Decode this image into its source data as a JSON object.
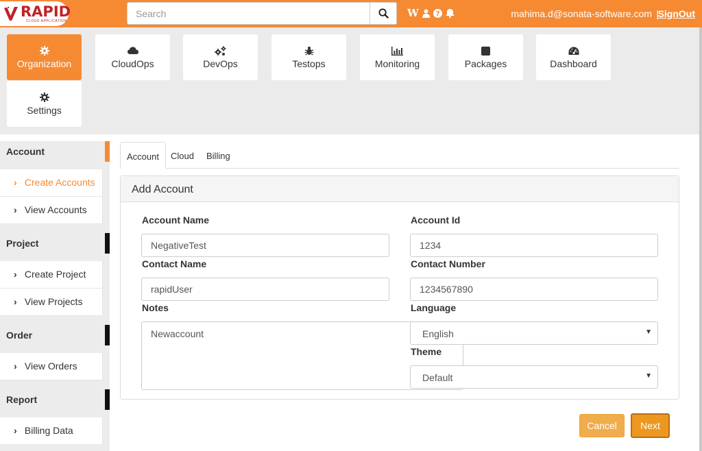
{
  "header": {
    "logo_text": "RAPID",
    "logo_subtext": "CLOUD APPLICATION",
    "search_placeholder": "Search",
    "user_email": "mahima.d@sonata-software.com",
    "separator": "|",
    "signout_label": "SignOut",
    "icons": [
      "wikipedia-icon",
      "user-icon",
      "help-icon",
      "bell-icon"
    ],
    "wiki_glyph": "W"
  },
  "modules": [
    {
      "label": "Organization",
      "icon": "gear-icon",
      "active": true
    },
    {
      "label": "CloudOps",
      "icon": "cloud-icon"
    },
    {
      "label": "DevOps",
      "icon": "gears-icon"
    },
    {
      "label": "Testops",
      "icon": "bug-icon"
    },
    {
      "label": "Monitoring",
      "icon": "bar-chart-icon"
    },
    {
      "label": "Packages",
      "icon": "package-icon"
    },
    {
      "label": "Dashboard",
      "icon": "dashboard-icon"
    },
    {
      "label": "Settings",
      "icon": "gear-icon"
    }
  ],
  "sidebar": {
    "sections": [
      {
        "title": "Account",
        "items": [
          "Create Accounts",
          "View Accounts"
        ]
      },
      {
        "title": "Project",
        "items": [
          "Create Project",
          "View Projects"
        ]
      },
      {
        "title": "Order",
        "items": [
          "View Orders"
        ]
      },
      {
        "title": "Report",
        "items": [
          "Billing Data"
        ]
      }
    ],
    "chevron": "›"
  },
  "tabs": [
    "Account",
    "Cloud",
    "Billing"
  ],
  "form": {
    "title": "Add Account",
    "account_name_label": "Account Name",
    "account_name_value": "NegativeTest",
    "account_id_label": "Account Id",
    "account_id_value": "1234",
    "contact_name_label": "Contact Name",
    "contact_name_value": "rapidUser",
    "contact_number_label": "Contact Number",
    "contact_number_value": "1234567890",
    "notes_label": "Notes",
    "notes_value": "Newaccount",
    "language_label": "Language",
    "language_value": "English",
    "theme_label": "Theme",
    "theme_value": "Default",
    "caret": "▼"
  },
  "buttons": {
    "cancel": "Cancel",
    "next": "Next"
  },
  "colors": {
    "brand_orange": "#f58a33",
    "logo_red": "#c22226",
    "cancel_bg": "#f0ad4e",
    "next_bg": "#ec971f"
  }
}
